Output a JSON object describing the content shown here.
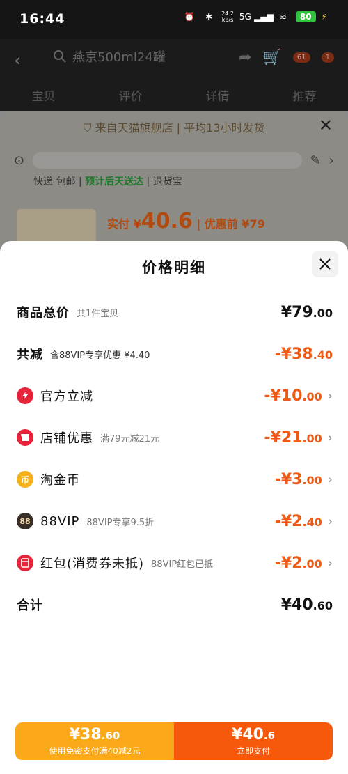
{
  "status": {
    "time": "16:44",
    "net_speed_value": "24.2",
    "net_speed_unit": "kb/s",
    "signal": "5G",
    "battery": "80"
  },
  "header": {
    "search_text": "燕京500ml24罐",
    "cart_badge": "61",
    "msg_badge": "1"
  },
  "tabs": [
    "宝贝",
    "评价",
    "详情",
    "推荐"
  ],
  "behind": {
    "notice": "来自天猫旗舰店 | 平均13小时发货",
    "delivery_a": "快递 包邮 | ",
    "delivery_green": "预计后天送达",
    "delivery_b": " | 退货宝",
    "price_label": "实付 ¥",
    "price_big": "40.6",
    "price_orig": " | 优惠前 ¥79"
  },
  "modal": {
    "title": "价格明细",
    "rows": [
      {
        "label": "商品总价",
        "sub": "共1件宝贝",
        "int": "¥79",
        "dec": ".00",
        "color": "black",
        "icon": ""
      },
      {
        "label": "共减",
        "sub": "含88VIP专享优惠 ¥4.40",
        "int": "-¥38",
        "dec": ".40",
        "color": "orange",
        "icon": ""
      },
      {
        "label": "官方立减",
        "sub": "",
        "int": "-¥10",
        "dec": ".00",
        "color": "orange",
        "icon": "lightning-icon"
      },
      {
        "label": "店铺优惠",
        "sub": "满79元减21元",
        "int": "-¥21",
        "dec": ".00",
        "color": "orange",
        "icon": "shop-icon"
      },
      {
        "label": "淘金币",
        "sub": "",
        "int": "-¥3",
        "dec": ".00",
        "color": "orange",
        "icon": "coin-icon"
      },
      {
        "label": "88VIP",
        "sub": "88VIP专享9.5折",
        "int": "-¥2",
        "dec": ".40",
        "color": "orange",
        "icon": "vip88-icon"
      },
      {
        "label": "红包(消费券未抵)",
        "sub": "88VIP红包已抵",
        "int": "-¥2",
        "dec": ".00",
        "color": "orange",
        "icon": "red-packet-icon"
      },
      {
        "label": "合计",
        "sub": "",
        "int": "¥40",
        "dec": ".60",
        "color": "black",
        "icon": ""
      }
    ],
    "vip88_glyph": "88",
    "coin_glyph": "币"
  },
  "bottom": {
    "left_int": "¥38",
    "left_dec": ".60",
    "left_label": "使用免密支付满40减2元",
    "right_int": "¥40",
    "right_dec": ".6",
    "right_label": "立即支付"
  },
  "colors": {
    "accent_orange": "#f05a14",
    "pay_yellow": "#fba91a",
    "pay_orange": "#f6580c",
    "red_icon": "#e8243c"
  }
}
